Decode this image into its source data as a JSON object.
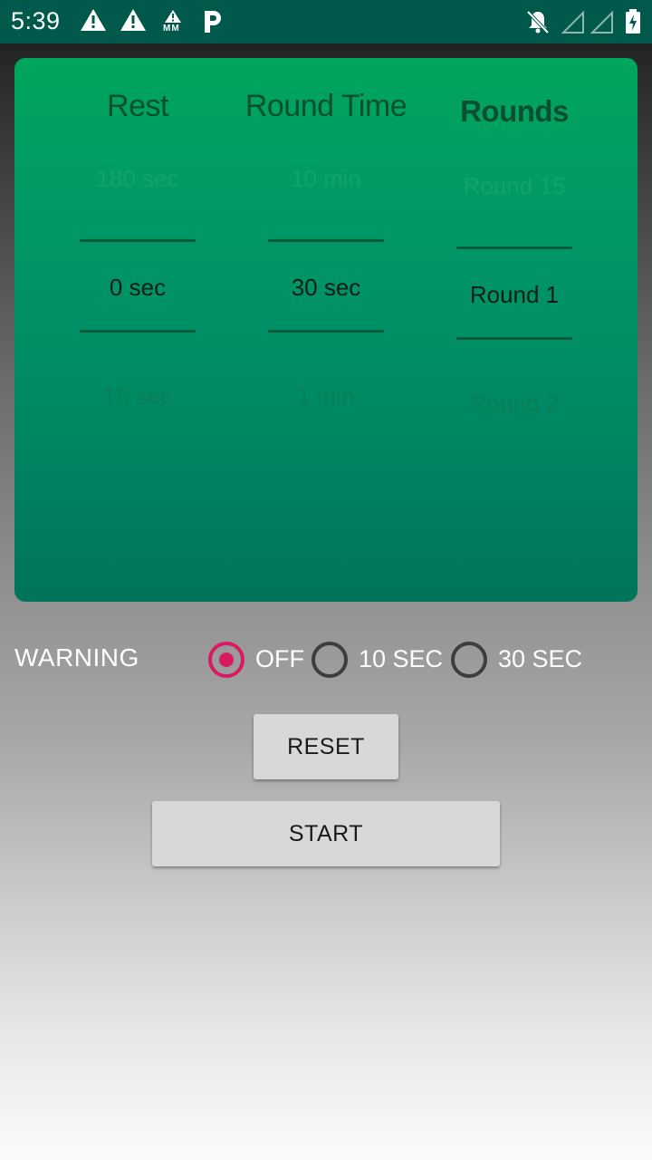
{
  "status_bar": {
    "time": "5:39",
    "icons": [
      "warning-icon",
      "warning-icon",
      "mm-warning-icon",
      "parking-icon",
      "notifications-off-icon",
      "signal-icon",
      "signal-icon",
      "battery-charging-icon"
    ],
    "mm_text": "MM",
    "parking_text": "P"
  },
  "picker": {
    "columns": [
      {
        "title": "Rest",
        "prev": "180 sec",
        "selected": "0 sec",
        "next": "15 sec"
      },
      {
        "title": "Round Time",
        "prev": "10 min",
        "selected": "30 sec",
        "next": "1 min"
      },
      {
        "title": "Rounds",
        "prev": "Round 15",
        "selected": "Round 1",
        "next": "Round 2"
      }
    ]
  },
  "warning": {
    "label": "WARNING",
    "options": [
      {
        "label": "OFF",
        "selected": true
      },
      {
        "label": "10 SEC",
        "selected": false
      },
      {
        "label": "30 SEC",
        "selected": false
      }
    ]
  },
  "buttons": {
    "reset": "RESET",
    "start": "START"
  },
  "colors": {
    "status_bar": "#00594a",
    "card_top": "#00a65c",
    "card_bottom": "#00745c",
    "radio_accent": "#d81b60"
  }
}
